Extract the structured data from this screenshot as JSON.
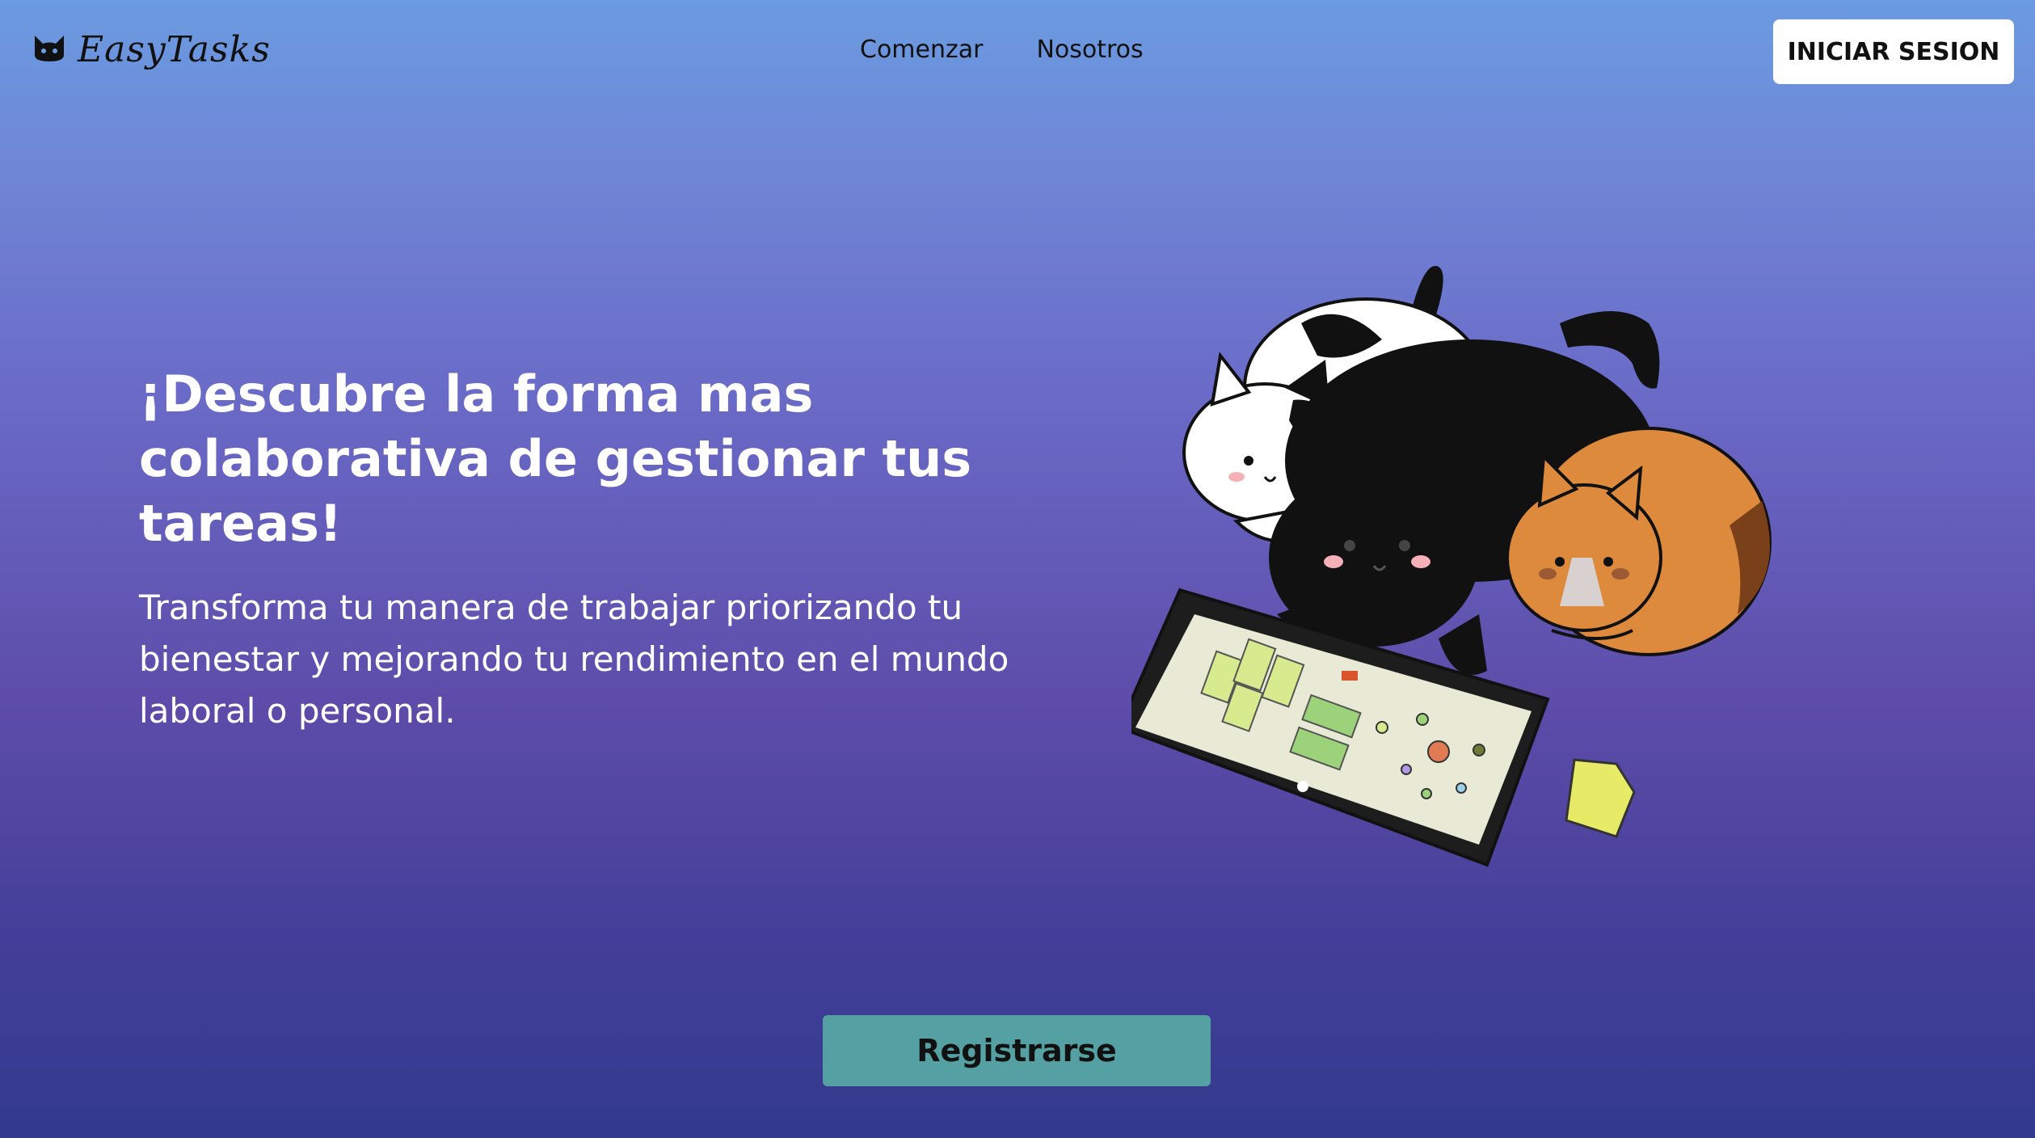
{
  "header": {
    "logo_text": "EasyTasks",
    "nav": [
      "Comenzar",
      "Nosotros"
    ],
    "login_label": "INICIAR SESION"
  },
  "hero": {
    "title": "¡Descubre la forma mas colaborativa de gestionar tus tareas!",
    "subtitle": "Transforma tu manera de trabajar priorizando tu bienestar y mejorando tu rendimiento en el mundo laboral o personal."
  },
  "cta": {
    "register_label": "Registrarse"
  },
  "colors": {
    "gradient_top": "#6b9be1",
    "gradient_bottom": "#323a8d",
    "register_button": "#54a0a3",
    "login_button": "#ffffff"
  },
  "illustration": {
    "icon": "cats-with-tablet-illustration"
  }
}
